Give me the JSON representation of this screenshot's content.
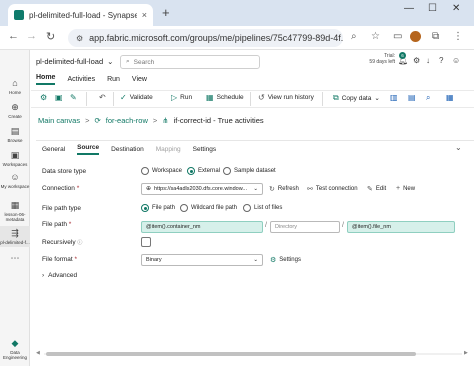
{
  "browser": {
    "tab_title": "pl-delimited-full-load - Synapse",
    "tab_close": "×",
    "new_tab": "+",
    "window_min": "—",
    "window_max": "☐",
    "window_close": "✕",
    "url": "app.fabric.microsoft.com/groups/me/pipelines/75c47799-89d-4f..."
  },
  "rail": {
    "items": [
      {
        "label": "Home"
      },
      {
        "label": "Create"
      },
      {
        "label": "Browse"
      },
      {
        "label": "Workspaces"
      },
      {
        "label": "My workspace"
      },
      {
        "label": "lesson-06-metadata"
      },
      {
        "label": "pl-delimited-f..."
      },
      {
        "label": "Data Engineering"
      }
    ]
  },
  "header": {
    "app_name": "pl-delimited-full-load",
    "search_placeholder": "Search",
    "trial_line1": "Trial:",
    "trial_line2": "59 days left",
    "notification_count": "6"
  },
  "ribbon": {
    "tabs": [
      {
        "label": "Home"
      },
      {
        "label": "Activities"
      },
      {
        "label": "Run"
      },
      {
        "label": "View"
      }
    ],
    "validate": "Validate",
    "run": "Run",
    "schedule": "Schedule",
    "view_run_history": "View run history",
    "copy_data": "Copy data"
  },
  "breadcrumb": {
    "root": "Main canvas",
    "sep1": ">",
    "level1": "for-each-row",
    "sep2": ">",
    "current": "if-correct-id - True activities"
  },
  "panel": {
    "tabs": [
      {
        "label": "General"
      },
      {
        "label": "Source"
      },
      {
        "label": "Destination"
      },
      {
        "label": "Mapping"
      },
      {
        "label": "Settings"
      }
    ],
    "data_store_type": {
      "label": "Data store type",
      "options": [
        {
          "label": "Workspace"
        },
        {
          "label": "External"
        },
        {
          "label": "Sample dataset"
        }
      ],
      "selected": "External"
    },
    "connection": {
      "label": "Connection",
      "required": "*",
      "value": "https://sa4adls2030.dfs.core.window...",
      "refresh": "Refresh",
      "test_connection": "Test connection",
      "edit": "Edit",
      "new": "New"
    },
    "file_path_type": {
      "label": "File path type",
      "options": [
        {
          "label": "File path"
        },
        {
          "label": "Wildcard file path"
        },
        {
          "label": "List of files"
        }
      ],
      "selected": "File path"
    },
    "file_path": {
      "label": "File path",
      "required": "*",
      "container": "@item().container_nm",
      "directory_placeholder": "Directory",
      "file": "@item().file_nm",
      "slash": "/"
    },
    "recursively": {
      "label": "Recursively",
      "checked": false
    },
    "file_format": {
      "label": "File format",
      "required": "*",
      "value": "Binary",
      "settings": "Settings"
    },
    "advanced": "Advanced"
  }
}
